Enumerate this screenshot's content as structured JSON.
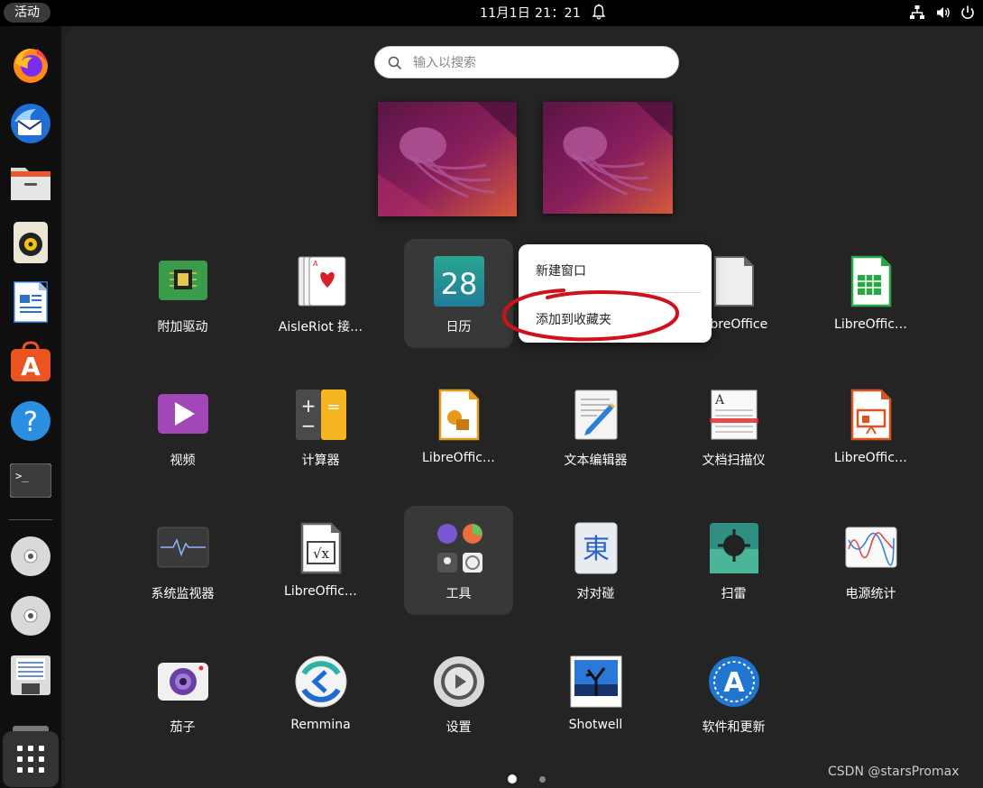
{
  "topbar": {
    "activities_label": "活动",
    "clock": "11月1日  21：21"
  },
  "dock": {
    "items": [
      "firefox-icon",
      "thunderbird-icon",
      "files-icon",
      "rhythmbox-icon",
      "libreoffice-writer-icon",
      "app-center-icon",
      "help-icon",
      "terminal-icon",
      "disc-icon",
      "disc-icon",
      "floppy-icon",
      "drive-icon"
    ],
    "show_apps_icon": "grid-icon"
  },
  "search": {
    "placeholder": "输入以搜索"
  },
  "apps": [
    {
      "label": "附加驱动",
      "icon": "chip-icon"
    },
    {
      "label": "AisleRiot 接…",
      "icon": "cards-icon"
    },
    {
      "label": "日历",
      "icon": "calendar-icon",
      "date": "28"
    },
    {
      "label": "LibreOffice",
      "icon": "libreoffice-icon"
    },
    {
      "label": "LibreOffic…",
      "icon": "libreoffice-calc-icon"
    },
    {
      "label": "视频",
      "icon": "video-icon"
    },
    {
      "label": "计算器",
      "icon": "calculator-icon"
    },
    {
      "label": "LibreOffic…",
      "icon": "libreoffice-draw-icon"
    },
    {
      "label": "文本编辑器",
      "icon": "text-editor-icon"
    },
    {
      "label": "文档扫描仪",
      "icon": "scanner-icon"
    },
    {
      "label": "LibreOffic…",
      "icon": "libreoffice-impress-icon"
    },
    {
      "label": "系统监视器",
      "icon": "system-monitor-icon"
    },
    {
      "label": "LibreOffic…",
      "icon": "libreoffice-math-icon"
    },
    {
      "label": "工具",
      "icon": "folder-tools-icon"
    },
    {
      "label": "对对碰",
      "icon": "mahjongg-icon"
    },
    {
      "label": "扫雷",
      "icon": "mines-icon"
    },
    {
      "label": "电源统计",
      "icon": "power-statistics-icon"
    },
    {
      "label": "茄子",
      "icon": "cheese-icon"
    },
    {
      "label": "Remmina",
      "icon": "remmina-icon"
    },
    {
      "label": "设置",
      "icon": "settings-icon"
    },
    {
      "label": "Shotwell",
      "icon": "shotwell-icon"
    },
    {
      "label": "软件和更新",
      "icon": "software-updates-icon"
    }
  ],
  "icon_glyphs": {
    "mahjongg": "東",
    "math": "√x"
  },
  "context_menu": {
    "new_window": "新建窗口",
    "add_favorite": "添加到收藏夹"
  },
  "annotation_color": "#d0101a",
  "pages": {
    "current": 1,
    "total": 2
  },
  "watermark": "CSDN @starsPromax"
}
